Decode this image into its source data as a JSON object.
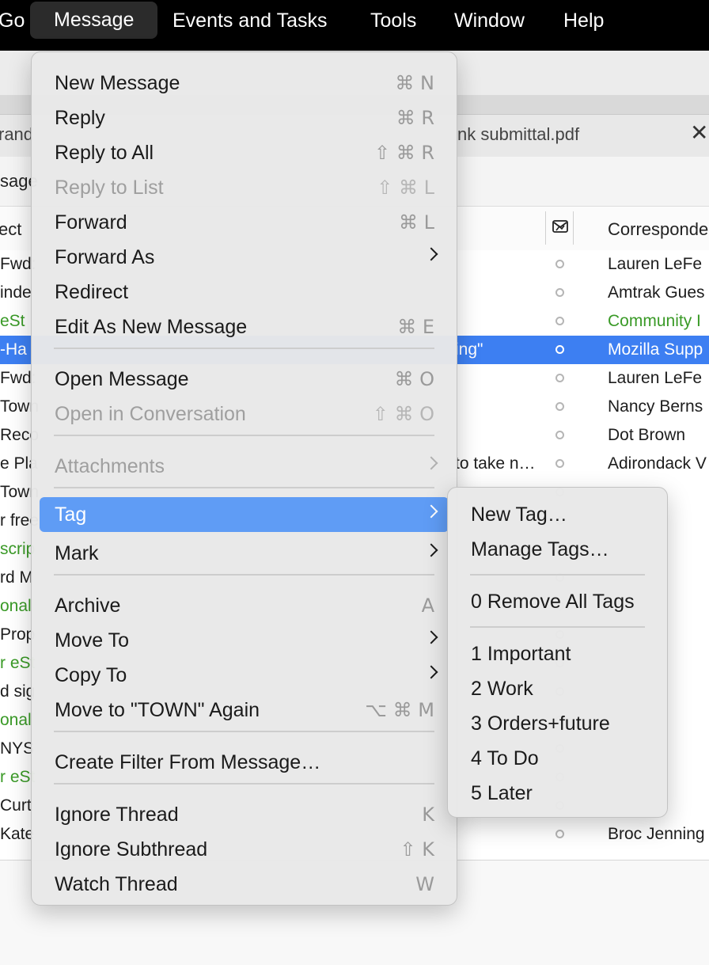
{
  "menubar": {
    "items": [
      "Go",
      "Message",
      "Events and Tasks",
      "Tools",
      "Window",
      "Help"
    ],
    "active": "Message"
  },
  "window": {
    "tab_left_text": "rand",
    "tab_right_text": "nk submittal.pdf",
    "message_label": "sage",
    "col_subject": "ect",
    "col_correspondent": "Corresponde",
    "rows": [
      {
        "subject": "Fwd:",
        "subject_tail": "",
        "correspondent": "Lauren LeFe",
        "green": false,
        "selected": false
      },
      {
        "subject": "inde",
        "subject_tail": "",
        "correspondent": "Amtrak Gues",
        "green": false,
        "selected": false
      },
      {
        "subject": "eSt",
        "subject_tail": "",
        "correspondent": "Community I",
        "green": true,
        "selected": false
      },
      {
        "subject": "-Ha",
        "subject_tail": "ing\"",
        "correspondent": "Mozilla Supp",
        "green": false,
        "selected": true
      },
      {
        "subject": "Fwd:",
        "subject_tail": "",
        "correspondent": "Lauren LeFe",
        "green": false,
        "selected": false
      },
      {
        "subject": "Town",
        "subject_tail": "",
        "correspondent": "Nancy Berns",
        "green": false,
        "selected": false
      },
      {
        "subject": "Reco",
        "subject_tail": "",
        "correspondent": "Dot Brown",
        "green": false,
        "selected": false
      },
      {
        "subject": "e Pla",
        "subject_tail": "to take n…",
        "correspondent": "Adirondack V",
        "green": false,
        "selected": false
      },
      {
        "subject": "Town",
        "subject_tail": "",
        "correspondent": "",
        "green": false,
        "selected": false
      },
      {
        "subject": "r free",
        "subject_tail": "",
        "correspondent": "",
        "green": false,
        "selected": false
      },
      {
        "subject": "scrip",
        "subject_tail": "",
        "correspondent": "",
        "green": true,
        "selected": false
      },
      {
        "subject": "rd M",
        "subject_tail": "",
        "correspondent": "",
        "green": false,
        "selected": false
      },
      {
        "subject": "onal",
        "subject_tail": "",
        "correspondent": "",
        "green": true,
        "selected": false
      },
      {
        "subject": "Prop",
        "subject_tail": "",
        "correspondent": "",
        "green": false,
        "selected": false
      },
      {
        "subject": "r eSt",
        "subject_tail": "",
        "correspondent": "",
        "green": true,
        "selected": false
      },
      {
        "subject": "d sig",
        "subject_tail": "",
        "correspondent": "",
        "green": false,
        "selected": false
      },
      {
        "subject": "onal",
        "subject_tail": "",
        "correspondent": "",
        "green": true,
        "selected": false
      },
      {
        "subject": "NYS",
        "subject_tail": "",
        "correspondent": "",
        "green": false,
        "selected": false
      },
      {
        "subject": "r eSt",
        "subject_tail": "",
        "correspondent": "",
        "green": true,
        "selected": false
      },
      {
        "subject": "Curt",
        "subject_tail": "",
        "correspondent": "",
        "green": false,
        "selected": false
      },
      {
        "subject": "Kate",
        "subject_tail": "",
        "correspondent": "Broc Jenning",
        "green": false,
        "selected": false
      }
    ]
  },
  "message_menu": {
    "items": [
      {
        "label": "New Message",
        "shortcut": "⌘ N",
        "disabled": false
      },
      {
        "label": "Reply",
        "shortcut": "⌘ R",
        "disabled": false
      },
      {
        "label": "Reply to All",
        "shortcut": "⇧ ⌘ R",
        "disabled": false
      },
      {
        "label": "Reply to List",
        "shortcut": "⇧ ⌘ L",
        "disabled": true
      },
      {
        "label": "Forward",
        "shortcut": "⌘ L",
        "disabled": false
      },
      {
        "label": "Forward As",
        "submenu": true,
        "disabled": false
      },
      {
        "label": "Redirect",
        "disabled": false
      },
      {
        "label": "Edit As New Message",
        "shortcut": "⌘ E",
        "disabled": false
      },
      {
        "label": "Open Message",
        "shortcut": "⌘ O",
        "disabled": false
      },
      {
        "label": "Open in Conversation",
        "shortcut": "⇧ ⌘ O",
        "disabled": true
      },
      {
        "label": "Attachments",
        "submenu": true,
        "disabled": true
      },
      {
        "label": "Tag",
        "submenu": true,
        "disabled": false,
        "highlighted": true
      },
      {
        "label": "Mark",
        "submenu": true,
        "disabled": false
      },
      {
        "label": "Archive",
        "shortcut": "A",
        "disabled": false
      },
      {
        "label": "Move To",
        "submenu": true,
        "disabled": false
      },
      {
        "label": "Copy To",
        "submenu": true,
        "disabled": false
      },
      {
        "label": "Move to \"TOWN\" Again",
        "shortcut": "⌥ ⌘ M",
        "disabled": false
      },
      {
        "label": "Create Filter From Message…",
        "disabled": false
      },
      {
        "label": "Ignore Thread",
        "shortcut": "K",
        "disabled": false
      },
      {
        "label": "Ignore Subthread",
        "shortcut": "⇧ K",
        "disabled": false
      },
      {
        "label": "Watch Thread",
        "shortcut": "W",
        "disabled": false
      }
    ]
  },
  "tag_submenu": {
    "items": [
      {
        "label": "New Tag…"
      },
      {
        "label": "Manage Tags…"
      },
      {
        "label": "0 Remove All Tags"
      },
      {
        "label": "1 Important"
      },
      {
        "label": "2 Work"
      },
      {
        "label": "3 Orders+future"
      },
      {
        "label": "4 To Do"
      },
      {
        "label": "5 Later"
      }
    ]
  },
  "colors": {
    "selection": "#3d7ff2",
    "menu_highlight": "#5f9cf5",
    "tag_green": "#3a9a27"
  }
}
